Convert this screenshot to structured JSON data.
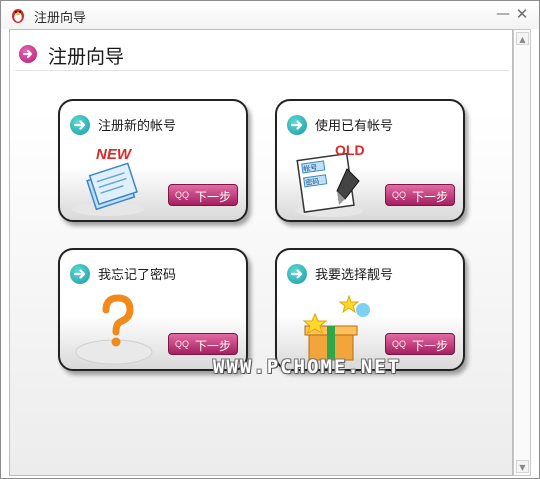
{
  "window": {
    "title": "注册向导",
    "minimize": "—",
    "close": "✕"
  },
  "header": {
    "title": "注册向导"
  },
  "cards": [
    {
      "label": "注册新的帐号",
      "button": "下一步",
      "art_text": "NEW"
    },
    {
      "label": "使用已有帐号",
      "button": "下一步",
      "art_text": "OLD",
      "art_sub1": "帐号",
      "art_sub2": "密码"
    },
    {
      "label": "我忘记了密码",
      "button": "下一步"
    },
    {
      "label": "我要选择靓号",
      "button": "下一步"
    }
  ],
  "scrollbar": {
    "up": "▲",
    "down": "▼"
  },
  "watermark": "WWW.PCHOME.NET",
  "colors": {
    "accent_pink": "#b1186f",
    "accent_teal": "#1c9aa2",
    "new_red": "#e0252b"
  }
}
